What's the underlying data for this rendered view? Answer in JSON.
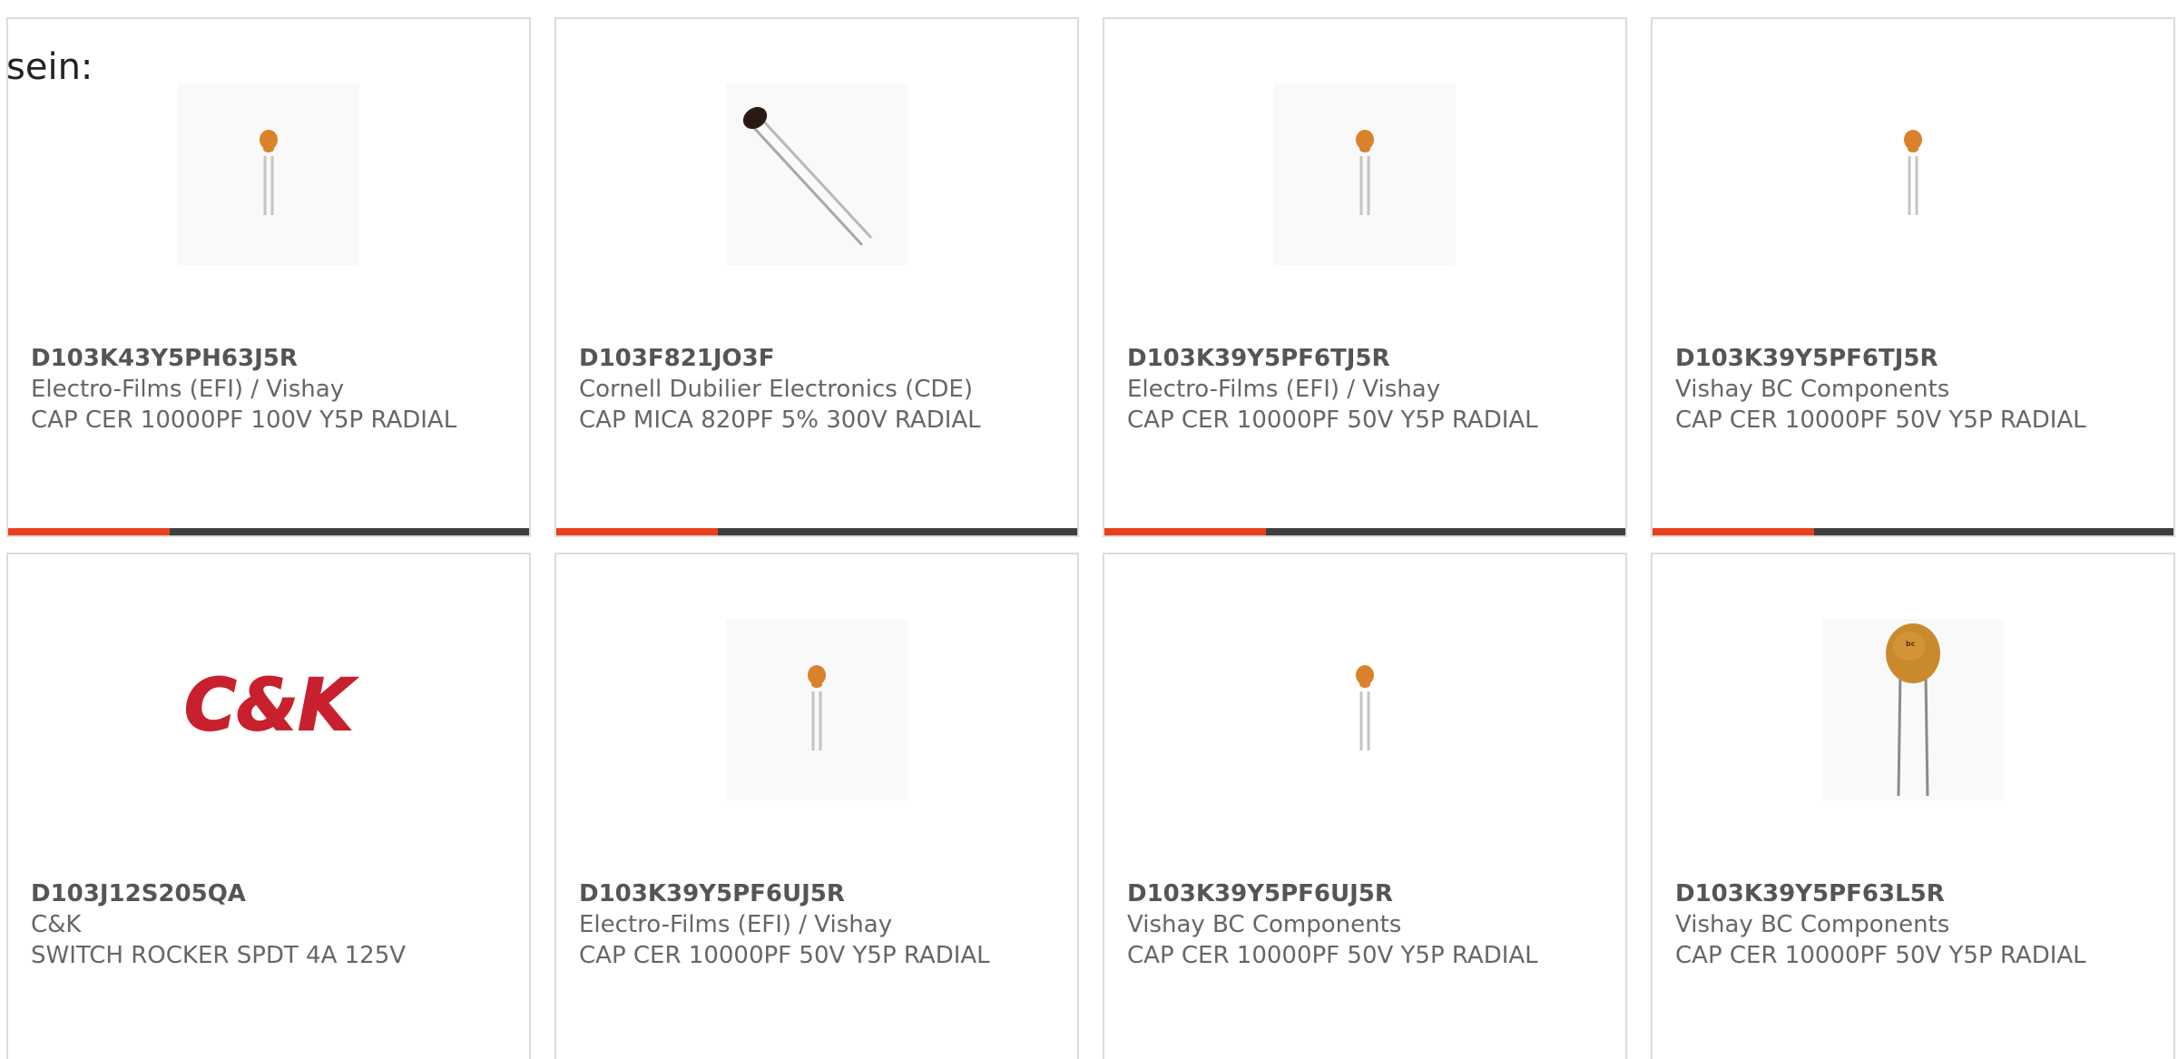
{
  "intro_text": "sein:",
  "colors": {
    "card_border": "#dcdcdc",
    "bar_track": "#3f3f3f",
    "bar_fill": "#e8401c",
    "ck_red": "#c8202f",
    "ck_black": "#1a1a1a",
    "capacitor_orange": "#d9822b"
  },
  "products": [
    {
      "part_number": "D103K43Y5PH63J5R",
      "manufacturer": "Electro-Films (EFI) / Vishay",
      "description": "CAP CER 10000PF 100V Y5P RADIAL",
      "image_icon": "small-ceramic-capacitor-icon",
      "bar_fraction": 0.31
    },
    {
      "part_number": "D103F821JO3F",
      "manufacturer": "Cornell Dubilier Electronics (CDE)",
      "description": "CAP MICA 820PF 5% 300V RADIAL",
      "image_icon": "mica-capacitor-icon",
      "bar_fraction": 0.31
    },
    {
      "part_number": "D103K39Y5PF6TJ5R",
      "manufacturer": "Electro-Films (EFI) / Vishay",
      "description": "CAP CER 10000PF 50V Y5P RADIAL",
      "image_icon": "small-ceramic-capacitor-icon",
      "bar_fraction": 0.31
    },
    {
      "part_number": "D103K39Y5PF6TJ5R",
      "manufacturer": "Vishay BC Components",
      "description": "CAP CER 10000PF 50V Y5P RADIAL",
      "image_icon": "small-ceramic-capacitor-icon",
      "bar_fraction": 0.31
    },
    {
      "part_number": "D103J12S205QA",
      "manufacturer": "C&K",
      "description": "SWITCH ROCKER SPDT 4A 125V",
      "image_icon": "ck-logo",
      "logo_text": "C&K",
      "bar_fraction": null
    },
    {
      "part_number": "D103K39Y5PF6UJ5R",
      "manufacturer": "Electro-Films (EFI) / Vishay",
      "description": "CAP CER 10000PF 50V Y5P RADIAL",
      "image_icon": "small-ceramic-capacitor-icon",
      "bar_fraction": null
    },
    {
      "part_number": "D103K39Y5PF6UJ5R",
      "manufacturer": "Vishay BC Components",
      "description": "CAP CER 10000PF 50V Y5P RADIAL",
      "image_icon": "small-ceramic-capacitor-icon",
      "bar_fraction": null
    },
    {
      "part_number": "D103K39Y5PF63L5R",
      "manufacturer": "Vishay BC Components",
      "description": "CAP CER 10000PF 50V Y5P RADIAL",
      "image_icon": "large-disc-capacitor-icon",
      "bar_fraction": null
    }
  ]
}
